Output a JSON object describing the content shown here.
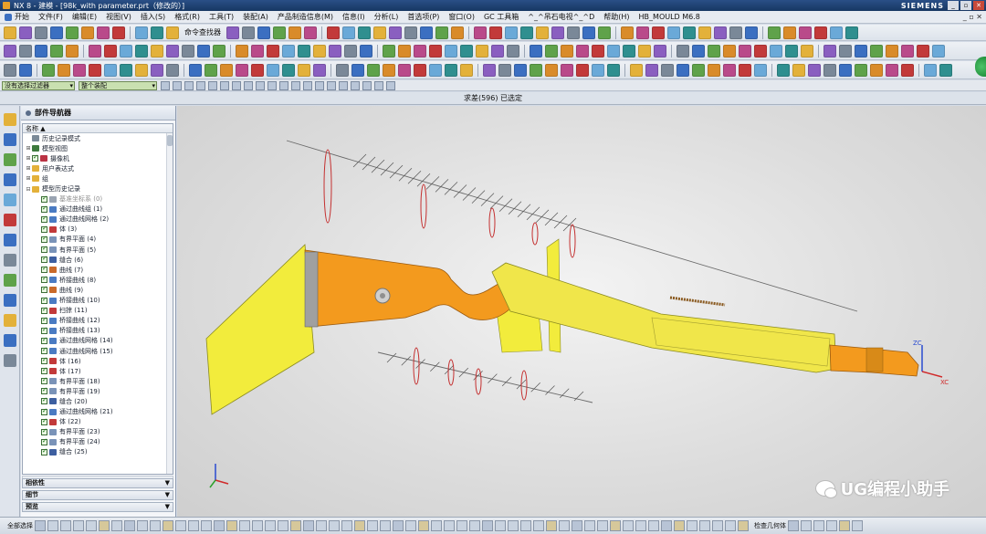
{
  "window": {
    "title": "NX 8 - 建模 - [98k_with parameter.prt（修改的）]",
    "brand": "SIEMENS",
    "controls": [
      "_",
      "▫",
      "✕"
    ]
  },
  "menubar": {
    "start": "开始",
    "items": [
      "文件(F)",
      "编辑(E)",
      "视图(V)",
      "插入(S)",
      "格式(R)",
      "工具(T)",
      "装配(A)",
      "产品制造信息(M)",
      "信息(I)",
      "分析(L)",
      "首选项(P)",
      "窗口(O)",
      "GC 工具箱",
      "^_^吊石电视^_^D",
      "帮助(H)",
      "HB_MOULD M6.8"
    ],
    "right_ctrls": "_ ▫ ✕"
  },
  "toolbar1": {
    "command_finder": "命令查找器"
  },
  "filterbar": {
    "filter_value": "没有选择过滤器",
    "scope_value": "整个装配"
  },
  "status": {
    "text": "求差(596) 已选定"
  },
  "navigator": {
    "title": "部件导航器",
    "column": "名称",
    "nodes": [
      {
        "label": "历史记录模式",
        "indent": 1,
        "exp": "",
        "check": false,
        "icon": "#7b8a98",
        "gray": false
      },
      {
        "label": "模型视图",
        "indent": 1,
        "exp": "⊞",
        "check": false,
        "icon": "#3d7a3d",
        "gray": false
      },
      {
        "label": "摄像机",
        "indent": 1,
        "exp": "⊞",
        "check": true,
        "icon": "#b34",
        "gray": false
      },
      {
        "label": "用户表达式",
        "indent": 1,
        "exp": "⊞",
        "check": false,
        "icon": "#e3b13a",
        "gray": false
      },
      {
        "label": "组",
        "indent": 1,
        "exp": "⊞",
        "check": false,
        "icon": "#e3b13a",
        "gray": false
      },
      {
        "label": "模型历史记录",
        "indent": 1,
        "exp": "⊟",
        "check": false,
        "icon": "#e3b13a",
        "gray": false
      },
      {
        "label": "基准坐标系 (0)",
        "indent": 2,
        "exp": "",
        "check": true,
        "icon": "#9aa4b2",
        "gray": true
      },
      {
        "label": "通过曲线组 (1)",
        "indent": 2,
        "exp": "",
        "check": true,
        "icon": "#4a7bc2",
        "gray": false
      },
      {
        "label": "通过曲线网格 (2)",
        "indent": 2,
        "exp": "",
        "check": true,
        "icon": "#4a7bc2",
        "gray": false
      },
      {
        "label": "体 (3)",
        "indent": 2,
        "exp": "",
        "check": true,
        "icon": "#c23a3a",
        "gray": false
      },
      {
        "label": "有界平面 (4)",
        "indent": 2,
        "exp": "",
        "check": true,
        "icon": "#7a93b8",
        "gray": false
      },
      {
        "label": "有界平面 (5)",
        "indent": 2,
        "exp": "",
        "check": true,
        "icon": "#7a93b8",
        "gray": false
      },
      {
        "label": "缝合 (6)",
        "indent": 2,
        "exp": "",
        "check": true,
        "icon": "#3d5fa0",
        "gray": false
      },
      {
        "label": "曲线 (7)",
        "indent": 2,
        "exp": "",
        "check": true,
        "icon": "#c96a2a",
        "gray": false
      },
      {
        "label": "桥接曲线 (8)",
        "indent": 2,
        "exp": "",
        "check": true,
        "icon": "#4a7bc2",
        "gray": false
      },
      {
        "label": "曲线 (9)",
        "indent": 2,
        "exp": "",
        "check": true,
        "icon": "#c96a2a",
        "gray": false
      },
      {
        "label": "桥接曲线 (10)",
        "indent": 2,
        "exp": "",
        "check": true,
        "icon": "#4a7bc2",
        "gray": false
      },
      {
        "label": "扫掠 (11)",
        "indent": 2,
        "exp": "",
        "check": true,
        "icon": "#c23a3a",
        "gray": false
      },
      {
        "label": "桥接曲线 (12)",
        "indent": 2,
        "exp": "",
        "check": true,
        "icon": "#4a7bc2",
        "gray": false
      },
      {
        "label": "桥接曲线 (13)",
        "indent": 2,
        "exp": "",
        "check": true,
        "icon": "#4a7bc2",
        "gray": false
      },
      {
        "label": "通过曲线网格 (14)",
        "indent": 2,
        "exp": "",
        "check": true,
        "icon": "#4a7bc2",
        "gray": false
      },
      {
        "label": "通过曲线网格 (15)",
        "indent": 2,
        "exp": "",
        "check": true,
        "icon": "#4a7bc2",
        "gray": false
      },
      {
        "label": "体 (16)",
        "indent": 2,
        "exp": "",
        "check": true,
        "icon": "#c23a3a",
        "gray": false
      },
      {
        "label": "体 (17)",
        "indent": 2,
        "exp": "",
        "check": true,
        "icon": "#c23a3a",
        "gray": false
      },
      {
        "label": "有界平面 (18)",
        "indent": 2,
        "exp": "",
        "check": true,
        "icon": "#7a93b8",
        "gray": false
      },
      {
        "label": "有界平面 (19)",
        "indent": 2,
        "exp": "",
        "check": true,
        "icon": "#7a93b8",
        "gray": false
      },
      {
        "label": "缝合 (20)",
        "indent": 2,
        "exp": "",
        "check": true,
        "icon": "#3d5fa0",
        "gray": false
      },
      {
        "label": "通过曲线网格 (21)",
        "indent": 2,
        "exp": "",
        "check": true,
        "icon": "#4a7bc2",
        "gray": false
      },
      {
        "label": "体 (22)",
        "indent": 2,
        "exp": "",
        "check": true,
        "icon": "#c23a3a",
        "gray": false
      },
      {
        "label": "有界平面 (23)",
        "indent": 2,
        "exp": "",
        "check": true,
        "icon": "#7a93b8",
        "gray": false
      },
      {
        "label": "有界平面 (24)",
        "indent": 2,
        "exp": "",
        "check": true,
        "icon": "#7a93b8",
        "gray": false
      },
      {
        "label": "缝合 (25)",
        "indent": 2,
        "exp": "",
        "check": true,
        "icon": "#3d5fa0",
        "gray": false
      }
    ],
    "sections": [
      "相依性",
      "细节",
      "预览"
    ]
  },
  "viewport": {
    "axis_x": "XC",
    "axis_z": "ZC",
    "stock_color": "#f39a1e",
    "barrel_color": "#f0e64a",
    "plate_color": "#f2ec3c"
  },
  "watermark": {
    "text": "UG编程小助手"
  },
  "bottombar": {
    "label_left": "全部选择",
    "label_right": "检查几何体"
  }
}
